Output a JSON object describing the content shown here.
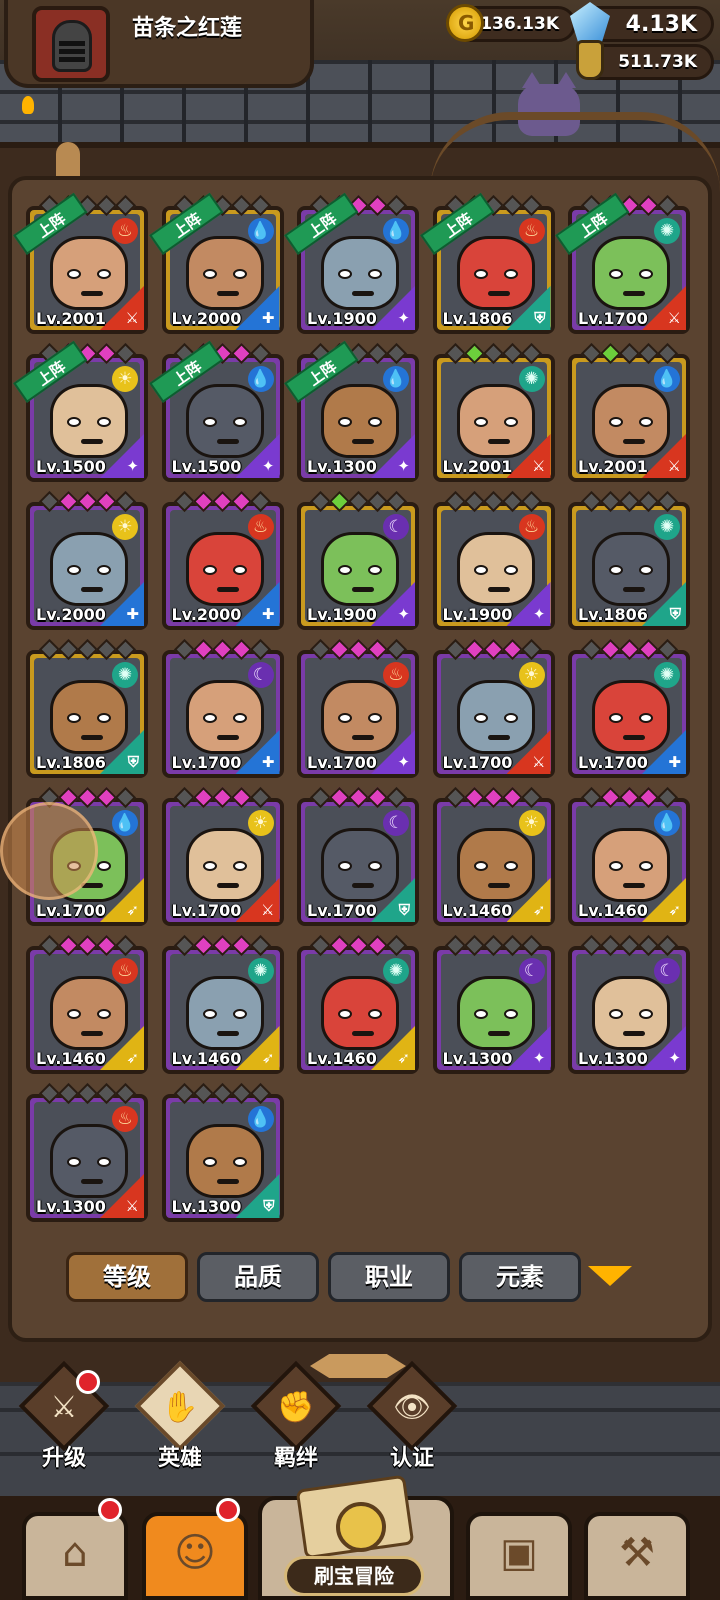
{
  "header": {
    "player_name": "苗条之红莲",
    "gold": "136.13K",
    "gems": "4.13K",
    "potions": "511.73K"
  },
  "heroes": [
    {
      "level": "Lv.2001",
      "quality": "gold",
      "element": "fire",
      "class": "warrior",
      "deployed": true,
      "pips": "green"
    },
    {
      "level": "Lv.2000",
      "quality": "gold",
      "element": "water",
      "class": "cleric",
      "deployed": true,
      "pips": "green"
    },
    {
      "level": "Lv.1900",
      "quality": "purple",
      "element": "water",
      "class": "mage",
      "deployed": true,
      "pips": "pink"
    },
    {
      "level": "Lv.1806",
      "quality": "gold",
      "element": "fire",
      "class": "tank",
      "deployed": true,
      "pips": "green"
    },
    {
      "level": "Lv.1700",
      "quality": "purple",
      "element": "wind",
      "class": "warrior",
      "deployed": true,
      "pips": "pink"
    },
    {
      "level": "Lv.1500",
      "quality": "purple",
      "element": "light",
      "class": "mage",
      "deployed": true,
      "pips": "pink"
    },
    {
      "level": "Lv.1500",
      "quality": "purple",
      "element": "water",
      "class": "mage",
      "deployed": true,
      "pips": "pink"
    },
    {
      "level": "Lv.1300",
      "quality": "purple",
      "element": "water",
      "class": "mage",
      "deployed": true,
      "pips": "grey"
    },
    {
      "level": "Lv.2001",
      "quality": "gold",
      "element": "wind",
      "class": "warrior",
      "deployed": false,
      "pips": "green"
    },
    {
      "level": "Lv.2001",
      "quality": "gold",
      "element": "water",
      "class": "warrior",
      "deployed": false,
      "pips": "green"
    },
    {
      "level": "Lv.2000",
      "quality": "purple",
      "element": "light",
      "class": "cleric",
      "deployed": false,
      "pips": "pink"
    },
    {
      "level": "Lv.2000",
      "quality": "purple",
      "element": "fire",
      "class": "cleric",
      "deployed": false,
      "pips": "pink"
    },
    {
      "level": "Lv.1900",
      "quality": "gold",
      "element": "dark",
      "class": "mage",
      "deployed": false,
      "pips": "green"
    },
    {
      "level": "Lv.1900",
      "quality": "gold",
      "element": "fire",
      "class": "mage",
      "deployed": false,
      "pips": "grey"
    },
    {
      "level": "Lv.1806",
      "quality": "gold",
      "element": "wind",
      "class": "tank",
      "deployed": false,
      "pips": "grey"
    },
    {
      "level": "Lv.1806",
      "quality": "gold",
      "element": "wind",
      "class": "tank",
      "deployed": false,
      "pips": "grey"
    },
    {
      "level": "Lv.1700",
      "quality": "purple",
      "element": "dark",
      "class": "cleric",
      "deployed": false,
      "pips": "pink"
    },
    {
      "level": "Lv.1700",
      "quality": "purple",
      "element": "fire",
      "class": "mage",
      "deployed": false,
      "pips": "pink"
    },
    {
      "level": "Lv.1700",
      "quality": "purple",
      "element": "light",
      "class": "warrior",
      "deployed": false,
      "pips": "pink"
    },
    {
      "level": "Lv.1700",
      "quality": "purple",
      "element": "wind",
      "class": "cleric",
      "deployed": false,
      "pips": "pink"
    },
    {
      "level": "Lv.1700",
      "quality": "purple",
      "element": "water",
      "class": "archer",
      "deployed": false,
      "pips": "pink"
    },
    {
      "level": "Lv.1700",
      "quality": "purple",
      "element": "light",
      "class": "warrior",
      "deployed": false,
      "pips": "pink"
    },
    {
      "level": "Lv.1700",
      "quality": "purple",
      "element": "dark",
      "class": "tank",
      "deployed": false,
      "pips": "pink"
    },
    {
      "level": "Lv.1460",
      "quality": "purple",
      "element": "light",
      "class": "archer",
      "deployed": false,
      "pips": "pink"
    },
    {
      "level": "Lv.1460",
      "quality": "purple",
      "element": "water",
      "class": "archer",
      "deployed": false,
      "pips": "pink"
    },
    {
      "level": "Lv.1460",
      "quality": "purple",
      "element": "fire",
      "class": "archer",
      "deployed": false,
      "pips": "pink"
    },
    {
      "level": "Lv.1460",
      "quality": "purple",
      "element": "wind",
      "class": "archer",
      "deployed": false,
      "pips": "pink"
    },
    {
      "level": "Lv.1460",
      "quality": "purple",
      "element": "wind",
      "class": "archer",
      "deployed": false,
      "pips": "pink"
    },
    {
      "level": "Lv.1300",
      "quality": "purple",
      "element": "dark",
      "class": "mage",
      "deployed": false,
      "pips": "grey"
    },
    {
      "level": "Lv.1300",
      "quality": "purple",
      "element": "dark",
      "class": "mage",
      "deployed": false,
      "pips": "grey"
    },
    {
      "level": "Lv.1300",
      "quality": "purple",
      "element": "fire",
      "class": "warrior",
      "deployed": false,
      "pips": "grey"
    },
    {
      "level": "Lv.1300",
      "quality": "purple",
      "element": "water",
      "class": "tank",
      "deployed": false,
      "pips": "grey"
    }
  ],
  "deployed_label": "上阵",
  "sort_tabs": [
    "等级",
    "品质",
    "职业",
    "元素"
  ],
  "sub_nav": [
    {
      "label": "升级",
      "glyph": "⚔",
      "badge": true,
      "active": false
    },
    {
      "label": "英雄",
      "glyph": "✋",
      "badge": false,
      "active": true
    },
    {
      "label": "羁绊",
      "glyph": "✊",
      "badge": false,
      "active": false
    },
    {
      "label": "认证",
      "glyph": "👁",
      "badge": false,
      "active": false
    }
  ],
  "bottom_nav": {
    "adventure_label": "刷宝冒险",
    "buttons": [
      {
        "name": "shop",
        "glyph": "⌂",
        "badge": true,
        "active": false
      },
      {
        "name": "heroes",
        "glyph": "☺",
        "badge": true,
        "active": true
      },
      {
        "name": "inventory",
        "glyph": "▣",
        "badge": false,
        "active": false
      },
      {
        "name": "forge",
        "glyph": "⚒",
        "badge": false,
        "active": false
      }
    ]
  },
  "colors": {
    "fire": "#d8361f",
    "water": "#2474d6",
    "wind": "#1fa58a",
    "light": "#e8c21a",
    "dark": "#6a2fb0"
  }
}
